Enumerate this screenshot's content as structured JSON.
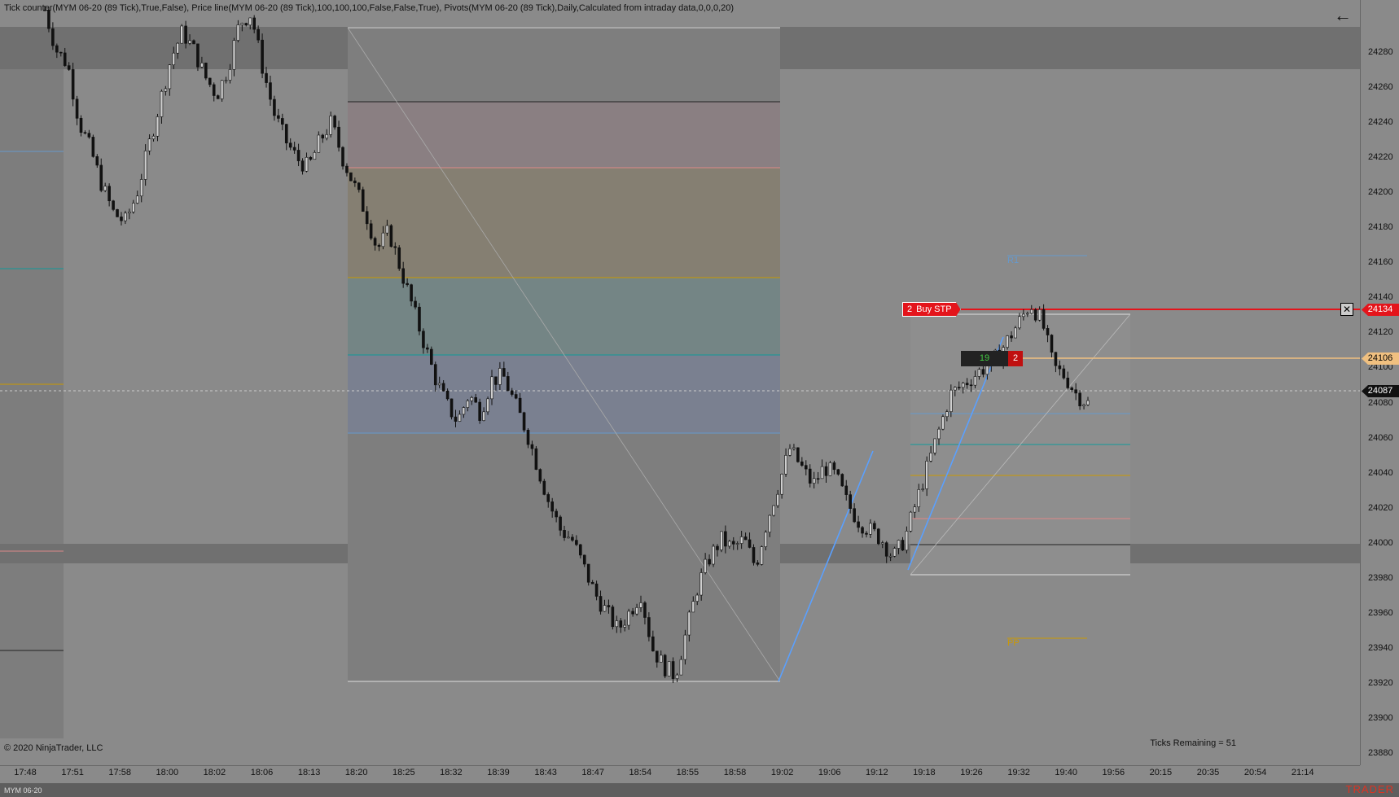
{
  "indicator_text": "Tick counter(MYM 06-20 (89 Tick),True,False), Price line(MYM 06-20 (89 Tick),100,100,100,False,False,True), Pivots(MYM 06-20 (89 Tick),Daily,Calculated from intraday data,0,0,0,20)",
  "copyright": "© 2020 NinjaTrader, LLC",
  "ticks_remaining": "Ticks Remaining = 51",
  "instrument": "MYM 06-20",
  "brand": "TRADER",
  "corner_button": "F",
  "icons": {
    "back": "arrow-left-icon",
    "close": "close-icon"
  },
  "colors": {
    "order_red": "#e4141b",
    "position_line": "#f0c080",
    "current_price": "#111111",
    "pnl_green": "#44cc44"
  },
  "price_scale": {
    "labels": [
      "24280",
      "24260",
      "24240",
      "24220",
      "24200",
      "24180",
      "24160",
      "24140",
      "24120",
      "24100",
      "24080",
      "24060",
      "24040",
      "24020",
      "24000",
      "23980",
      "23960",
      "23940",
      "23920",
      "23900",
      "23880"
    ]
  },
  "time_axis": {
    "labels": [
      "17:48",
      "17:51",
      "17:58",
      "18:00",
      "18:02",
      "18:06",
      "18:13",
      "18:20",
      "18:25",
      "18:32",
      "18:39",
      "18:43",
      "18:47",
      "18:54",
      "18:55",
      "18:58",
      "19:02",
      "19:06",
      "19:12",
      "19:18",
      "19:26",
      "19:32",
      "19:40",
      "19:56",
      "20:15",
      "20:35",
      "20:54",
      "21:14"
    ]
  },
  "price_tags": {
    "order": "24134",
    "position": "24106",
    "last": "24087"
  },
  "order": {
    "qty": "2",
    "label": "Buy STP"
  },
  "position": {
    "pnl": "19",
    "qty": "2"
  },
  "pivots": {
    "r1": "R1",
    "pp": "PP"
  },
  "chart_data": {
    "type": "candlestick",
    "ylim": [
      23875,
      24293
    ],
    "order_price": 24134,
    "position_price": 24106,
    "last_price": 24087,
    "close_path": [
      24292,
      24270,
      24262,
      24230,
      24215,
      24195,
      24180,
      24175,
      24190,
      24215,
      24240,
      24265,
      24280,
      24270,
      24255,
      24245,
      24260,
      24285,
      24290,
      24260,
      24235,
      24220,
      24210,
      24205,
      24220,
      24230,
      24210,
      24195,
      24180,
      24160,
      24170,
      24150,
      24130,
      24110,
      24090,
      24075,
      24065,
      24080,
      24070,
      24088,
      24090,
      24075,
      24060,
      24040,
      24020,
      24005,
      24000,
      23985,
      23970,
      23960,
      23950,
      23960,
      23970,
      23940,
      23930,
      23925,
      23950,
      23975,
      23990,
      24000,
      23995,
      24000,
      23985,
      24010,
      24030,
      24050,
      24040,
      24030,
      24040,
      24035,
      24020,
      24010,
      24005,
      24000,
      23990,
      24000,
      24020,
      24040,
      24060,
      24080,
      24085,
      24090,
      24095,
      24100,
      24110,
      24120,
      24130,
      24120,
      24095,
      24090,
      24080,
      24075
    ]
  }
}
